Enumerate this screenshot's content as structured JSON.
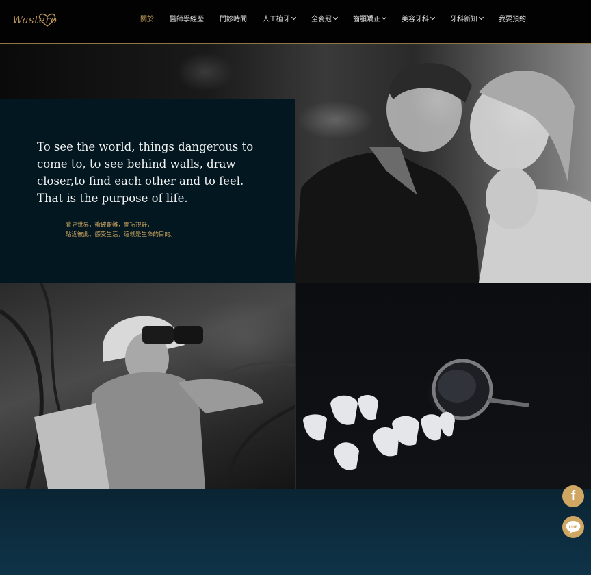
{
  "header": {
    "logo_text": "Wastero",
    "nav": [
      {
        "label": "關於",
        "active": true,
        "dropdown": false
      },
      {
        "label": "醫師學經歷",
        "active": false,
        "dropdown": false
      },
      {
        "label": "門診時間",
        "active": false,
        "dropdown": false
      },
      {
        "label": "人工植牙",
        "active": false,
        "dropdown": true
      },
      {
        "label": "全瓷冠",
        "active": false,
        "dropdown": true
      },
      {
        "label": "齒顎矯正",
        "active": false,
        "dropdown": true
      },
      {
        "label": "美容牙科",
        "active": false,
        "dropdown": true
      },
      {
        "label": "牙科新知",
        "active": false,
        "dropdown": true
      },
      {
        "label": "我要預約",
        "active": false,
        "dropdown": false
      }
    ]
  },
  "hero": {
    "quote_en": "To see the world, things dangerous to come to, to see behind walls, draw closer,to find each other and to feel. That is the purpose of life.",
    "quote_zh_line1": "看見世界，衝破艱難，開拓視野，",
    "quote_zh_line2": "貼近彼此，感受生活，這就是生命的目的。"
  },
  "social": {
    "facebook_icon": "facebook-icon",
    "line_icon": "line-icon",
    "line_text": "LINE"
  },
  "colors": {
    "accent_gold": "#c9a35f",
    "panel_navy": "#031721",
    "header_bg": "#020202"
  }
}
